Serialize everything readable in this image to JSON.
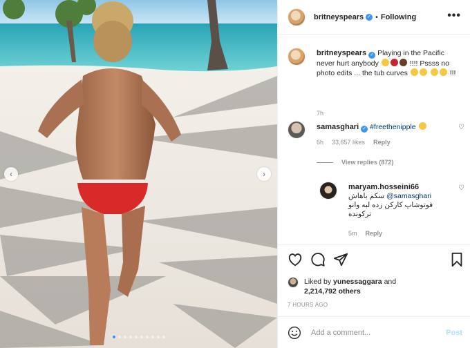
{
  "post": {
    "dots_count": 10,
    "active_dot": 0
  },
  "header": {
    "username": "britneyspears",
    "separator": "•",
    "follow_status": "Following",
    "more_label": "•••"
  },
  "caption": {
    "username": "britneyspears",
    "text_part1": "Playing in the Pacific never hurt anybody",
    "text_part2": "!!!! Pssss no photo edits ... the tub curves",
    "text_part3": "!!!",
    "time_ago": "7h"
  },
  "comments": [
    {
      "username": "samasghari",
      "mention": "#freethenipple",
      "time_ago": "6h",
      "likes": "33,657 likes",
      "reply_label": "Reply",
      "view_replies": "View replies (872)"
    },
    {
      "username": "maryam.hosseini66",
      "line1": "سکم باهاش",
      "mention": "@samasghari",
      "line2": "فوتوشاپ کارکن زده لبه وانو ترکونده",
      "time_ago": "5m",
      "reply_label": "Reply"
    }
  ],
  "likes": {
    "prefix": "Liked by",
    "user": "yunessaggara",
    "and": "and",
    "others": "2,214,792 others"
  },
  "timestamp": "7 HOURS AGO",
  "add_comment": {
    "placeholder": "Add a comment...",
    "post_label": "Post"
  },
  "colors": {
    "accent": "#3897f0",
    "text": "#262626",
    "muted": "#8e8e8e",
    "post_disabled": "#b2dffc"
  },
  "icons": [
    "heart-icon",
    "comment-icon",
    "share-icon",
    "bookmark-icon",
    "smile-icon",
    "verified-badge-icon",
    "chevron-left-icon",
    "chevron-right-icon"
  ]
}
